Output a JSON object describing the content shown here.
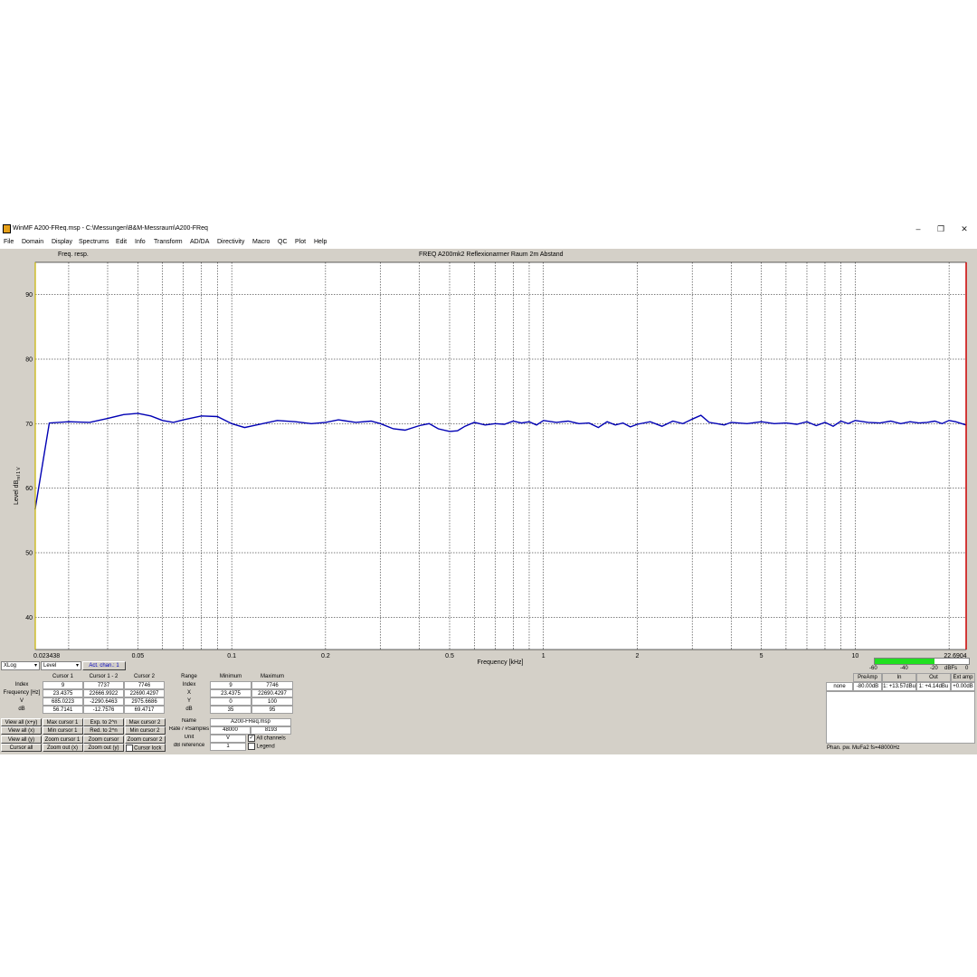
{
  "window": {
    "title": "WinMF   A200-FReq.msp - C:\\Messungen\\B&M-Messraum\\A200-FReq",
    "minimize": "‒",
    "restore": "❐",
    "close": "✕"
  },
  "menu": [
    "File",
    "Domain",
    "Display",
    "Spectrums",
    "Edit",
    "Info",
    "Transform",
    "AD/DA",
    "Directivity",
    "Macro",
    "QC",
    "Plot",
    "Help"
  ],
  "plot": {
    "label": "Freq. resp.",
    "title": "FREQ A200mk2     Reflexionarmer Raum 2m Abstand",
    "xlabel": "Frequency [kHz]",
    "ylabel": "Level dB",
    "ylabel_sub": "rel 1 V"
  },
  "chart_data": {
    "type": "line",
    "x_scale": "log",
    "xlim": [
      0.023438,
      22.6904
    ],
    "ylim": [
      35,
      95
    ],
    "xticks": [
      0.05,
      0.1,
      0.2,
      0.5,
      1,
      2,
      5,
      10
    ],
    "xtick_labels": [
      "0.023438",
      "0.05",
      "0.1",
      "0.2",
      "0.5",
      "1",
      "2",
      "5",
      "10",
      "22.6904"
    ],
    "yticks": [
      40,
      50,
      60,
      70,
      80,
      90
    ],
    "grid": true,
    "series": [
      {
        "color": "#0000b4",
        "x": [
          0.0234,
          0.026,
          0.03,
          0.035,
          0.04,
          0.045,
          0.05,
          0.055,
          0.06,
          0.065,
          0.07,
          0.08,
          0.09,
          0.1,
          0.11,
          0.12,
          0.14,
          0.16,
          0.18,
          0.2,
          0.22,
          0.25,
          0.28,
          0.3,
          0.33,
          0.36,
          0.4,
          0.43,
          0.46,
          0.5,
          0.53,
          0.56,
          0.6,
          0.65,
          0.7,
          0.75,
          0.8,
          0.85,
          0.9,
          0.95,
          1.0,
          1.1,
          1.2,
          1.3,
          1.4,
          1.5,
          1.6,
          1.7,
          1.8,
          1.9,
          2.0,
          2.2,
          2.4,
          2.6,
          2.8,
          3.0,
          3.2,
          3.4,
          3.6,
          3.8,
          4.0,
          4.5,
          5.0,
          5.5,
          6.0,
          6.5,
          7.0,
          7.5,
          8.0,
          8.5,
          9.0,
          9.5,
          10,
          11,
          12,
          13,
          14,
          15,
          16,
          17,
          18,
          19,
          20,
          21,
          22.69
        ],
        "y": [
          56.7,
          70.1,
          70.3,
          70.2,
          70.8,
          71.4,
          71.6,
          71.2,
          70.5,
          70.2,
          70.6,
          71.2,
          71.1,
          70.0,
          69.4,
          69.8,
          70.5,
          70.3,
          70.0,
          70.2,
          70.6,
          70.2,
          70.4,
          70.0,
          69.2,
          69.0,
          69.7,
          70.0,
          69.2,
          68.8,
          68.9,
          69.6,
          70.2,
          69.8,
          70.0,
          69.9,
          70.4,
          70.1,
          70.3,
          69.8,
          70.5,
          70.2,
          70.4,
          70.0,
          70.1,
          69.4,
          70.3,
          69.8,
          70.1,
          69.5,
          69.9,
          70.3,
          69.6,
          70.4,
          70.0,
          70.7,
          71.3,
          70.2,
          70.0,
          69.8,
          70.2,
          70.0,
          70.3,
          70.0,
          70.1,
          69.9,
          70.3,
          69.7,
          70.2,
          69.6,
          70.4,
          70.0,
          70.5,
          70.2,
          70.1,
          70.4,
          70.0,
          70.3,
          70.1,
          70.2,
          70.4,
          70.0,
          70.5,
          70.3,
          69.8
        ]
      }
    ]
  },
  "controls": {
    "xscale": "XLog",
    "ytype": "Level",
    "act_chan": "Act. chan.: 1"
  },
  "cursor_table": {
    "headers": [
      "",
      "Cursor 1",
      "Cursor 1 - 2",
      "Cursor 2"
    ],
    "rows": [
      [
        "Index",
        "9",
        "7737",
        "7746"
      ],
      [
        "Frequency [Hz]",
        "23.4375",
        "22666.9922",
        "22690.4297"
      ],
      [
        "V",
        "685.0223",
        "-2290.6463",
        "2975.6686"
      ],
      [
        "dB",
        "56.7141",
        "-12.7576",
        "69.4717"
      ]
    ]
  },
  "range_table": {
    "headers": [
      "Range",
      "Minimum",
      "Maximum"
    ],
    "rows": [
      [
        "Index",
        "9",
        "7746"
      ],
      [
        "X",
        "23.4375",
        "22690.4297"
      ],
      [
        "Y",
        "0",
        "100"
      ],
      [
        "dB",
        "35",
        "95"
      ]
    ]
  },
  "cursor_buttons": [
    [
      "View all (x+y)",
      "Max cursor 1",
      "Exp. to 2^n",
      "Max cursor 2"
    ],
    [
      "View all (x)",
      "Min cursor 1",
      "Red. to 2^n",
      "Min cursor 2"
    ],
    [
      "View all (y)",
      "Zoom cursor 1",
      "Zoom cursor",
      "Zoom cursor 2"
    ],
    [
      "Cursor all",
      "Zoom out (x)",
      "Zoom out (y)",
      "Cursor lock"
    ]
  ],
  "file_info": {
    "name_label": "Name",
    "name_value": "A200-FReq.msp",
    "rate_label": "Rate / #Samples",
    "rate_value": "48000",
    "samples_value": "8193",
    "unit_label": "Unit",
    "unit_value": "V",
    "all_channels": "All channels",
    "dbref_label": "dB reference",
    "dbref_value": "1",
    "legend": "Legend"
  },
  "meter": {
    "ticks": [
      "-60",
      "-40",
      "-20",
      "dBFs",
      "0"
    ],
    "headers": [
      "",
      "PreAmp",
      "In",
      "Out",
      "Ext amp"
    ],
    "row": [
      "none",
      "-80.00dB",
      "1: +13.57dBu",
      "1: +4.14dBu",
      "+0.00dB"
    ],
    "status": "Phan. pw.   MuFa2 fs=48000Hz"
  }
}
